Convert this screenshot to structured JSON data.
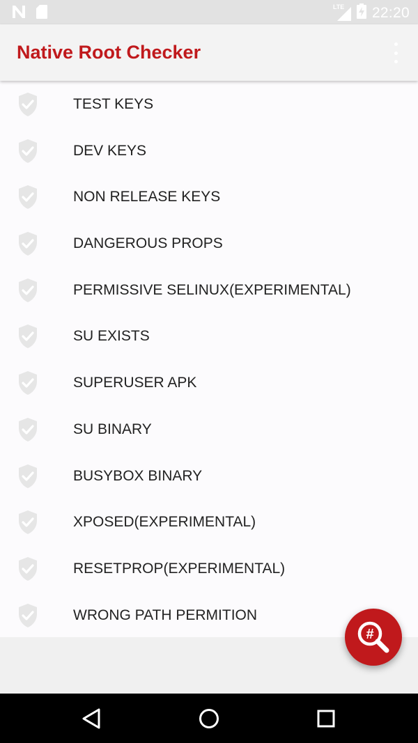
{
  "status_bar": {
    "time": "22:20",
    "network_label": "LTE",
    "icons": [
      "n-notification-icon",
      "sd-card-icon",
      "lte-signal-icon",
      "battery-charging-icon"
    ]
  },
  "app_bar": {
    "title": "Native Root Checker",
    "title_color": "#c0191c",
    "menu_icon": "more-vert-icon"
  },
  "checks": [
    {
      "label": "TEST KEYS",
      "icon": "shield-check-icon"
    },
    {
      "label": "DEV KEYS",
      "icon": "shield-check-icon"
    },
    {
      "label": "NON RELEASE KEYS",
      "icon": "shield-check-icon"
    },
    {
      "label": "DANGEROUS PROPS",
      "icon": "shield-check-icon"
    },
    {
      "label": "PERMISSIVE SELINUX(EXPERIMENTAL)",
      "icon": "shield-check-icon"
    },
    {
      "label": "SU EXISTS",
      "icon": "shield-check-icon"
    },
    {
      "label": "SUPERUSER APK",
      "icon": "shield-check-icon"
    },
    {
      "label": "SU BINARY",
      "icon": "shield-check-icon"
    },
    {
      "label": "BUSYBOX BINARY",
      "icon": "shield-check-icon"
    },
    {
      "label": "XPOSED(EXPERIMENTAL)",
      "icon": "shield-check-icon"
    },
    {
      "label": "RESETPROP(EXPERIMENTAL)",
      "icon": "shield-check-icon"
    },
    {
      "label": "WRONG PATH PERMITION",
      "icon": "shield-check-icon"
    }
  ],
  "fab": {
    "icon": "hash-search-icon",
    "glyph": "#",
    "color": "#c0191c"
  },
  "nav_bar": {
    "icons": [
      "back-triangle-icon",
      "home-circle-icon",
      "recents-square-icon"
    ]
  }
}
